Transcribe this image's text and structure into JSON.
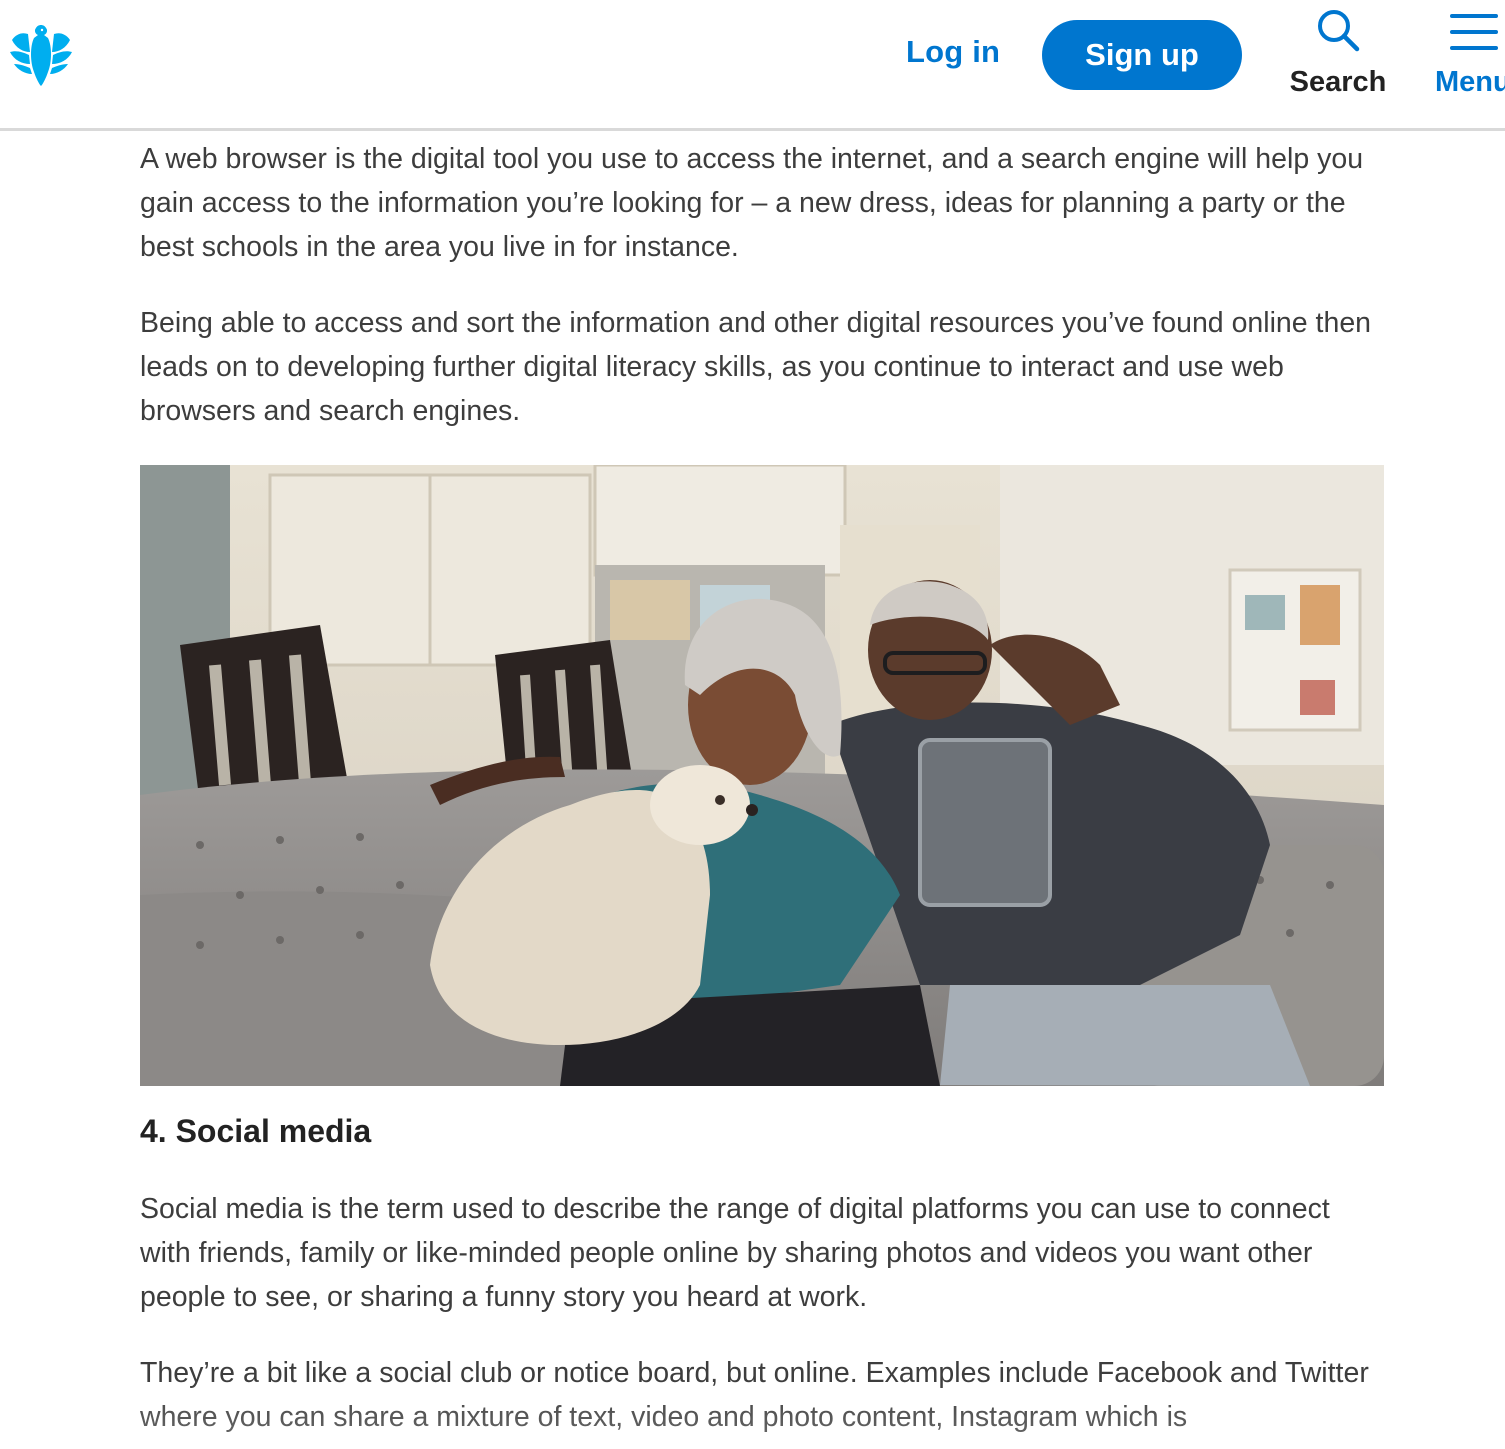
{
  "header": {
    "logo_name": "eagle-logo",
    "login_label": "Log in",
    "signup_label": "Sign up",
    "search_label": "Search",
    "menu_label": "Menu",
    "accent_color": "#0076cf"
  },
  "article": {
    "paragraphs_top": [
      "A web browser is the digital tool you use to access the internet, and a search engine will help you gain access to the information you’re looking for – a new dress, ideas for planning a party or the best schools in the area you live in for instance.",
      "Being able to access and sort the information and other digital resources you’ve found online then leads on to developing further digital literacy skills, as you continue to interact and use web browsers and search engines."
    ],
    "section_heading": "4. Social media",
    "paragraphs_bottom": [
      "Social media is the term used to describe the range of digital platforms you can use to connect with friends, family or like-minded people online by sharing photos and videos you want other people to see, or sharing a funny story you heard at work.",
      "They’re a bit like a social club or notice board, but online. Examples include Facebook and Twitter where you can share a mixture of text, video and photo content, Instagram which is"
    ]
  }
}
